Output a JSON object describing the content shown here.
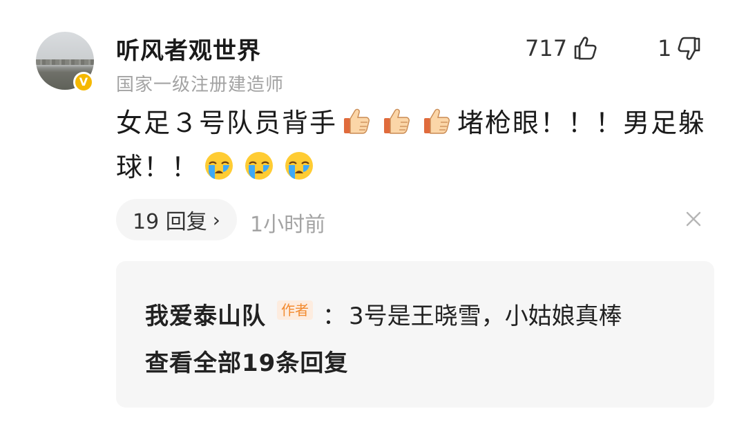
{
  "comment": {
    "username": "听风者观世界",
    "user_title": "国家一级注册建造师",
    "verified_badge": "V",
    "like_count": "717",
    "dislike_count": "1",
    "text_part1": "女足３号队员背手",
    "text_part2": "堵枪眼！！！男足躲球！！",
    "reply_count_label": "19 回复",
    "timestamp": "1小时前",
    "icons": {
      "like": "thumbs-up-outline-icon",
      "dislike": "thumbs-down-outline-icon",
      "emoji_thumb": "thumbs-up-emoji-icon",
      "emoji_cry": "crying-face-emoji-icon",
      "close": "close-icon",
      "chevron": "chevron-right-icon"
    },
    "colors": {
      "badge": "#f5b800",
      "author_tag": "#f28a2e",
      "secondary_text": "#a3a3a3"
    }
  },
  "reply": {
    "author": "我爱泰山队",
    "author_tag": "作者",
    "separator": "：",
    "text": "3号是王晓雪，小姑娘真棒",
    "view_all_label": "查看全部19条回复"
  }
}
